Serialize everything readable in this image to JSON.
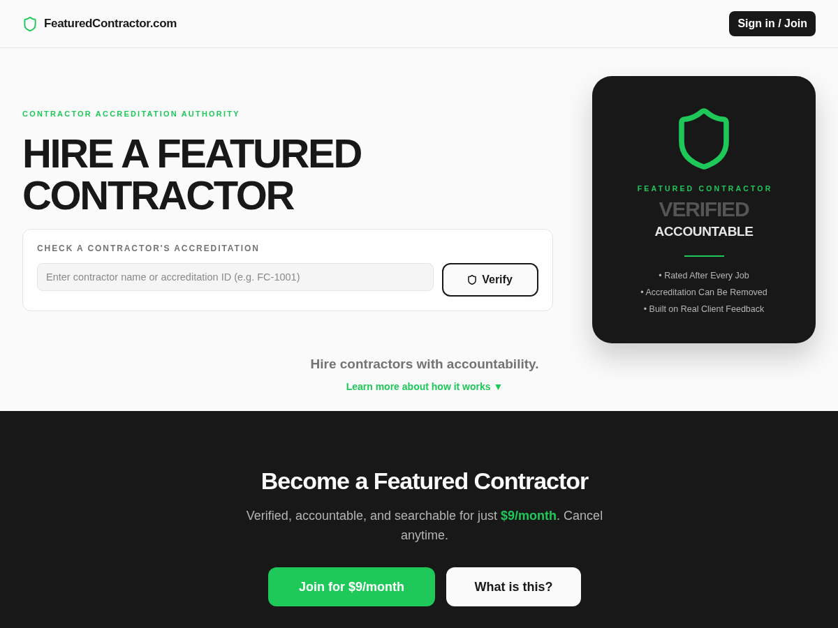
{
  "header": {
    "logo_text": "FeaturedContractor.com",
    "sign_in_button": "Sign in / Join"
  },
  "hero": {
    "eyebrow": "CONTRACTOR ACCREDITATION AUTHORITY",
    "title_lines": [
      "HIRE A FEATURED",
      "CONTRACTOR"
    ],
    "check": {
      "label": "CHECK A CONTRACTOR'S ACCREDITATION",
      "placeholder": "Enter contractor name or accreditation ID (e.g. FC-1001)",
      "button": "Verify"
    }
  },
  "badge_card": {
    "label": "FEATURED CONTRACTOR",
    "headline": "VERIFIED",
    "subline": "ACCOUNTABLE",
    "points": [
      "• Rated After Every Job",
      "• Accreditation Can Be Removed",
      "• Built on Real Client Feedback"
    ]
  },
  "tagline": "Hire contractors with accountability.",
  "learn_more_link": "Learn more about how it works ▼",
  "cta": {
    "title": "Become a Featured Contractor",
    "text": "Verified, accountable, and searchable for just **$9/month**. Cancel anytime.",
    "buttons": [
      {
        "label": "Join for $9/month",
        "kind": "primary"
      },
      {
        "label": "What is this?",
        "kind": "secondary"
      }
    ]
  }
}
